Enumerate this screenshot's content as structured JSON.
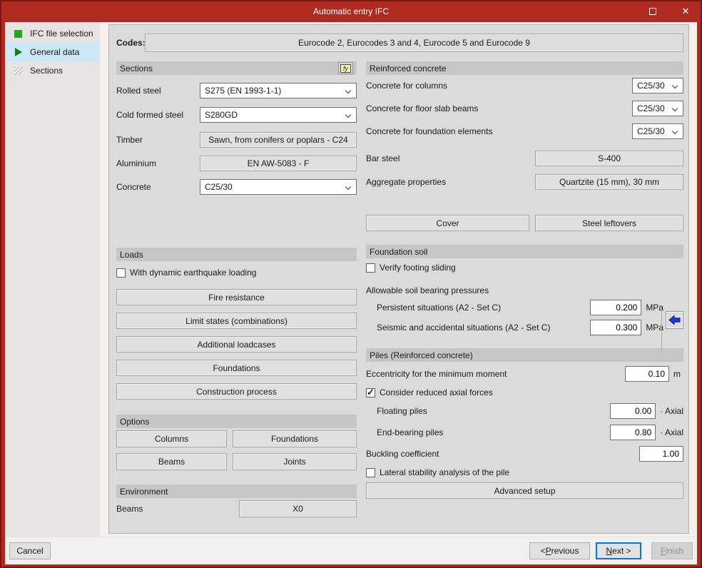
{
  "glyphs": {
    "close": "✕",
    "check": "✓",
    "fy": "fy"
  },
  "colors": {
    "titlebar_red": "#AF2B1F",
    "selected_step_blue": "#CBE8F6",
    "default_button_blue": "#0078D7",
    "arrow_blue": "#2438D8",
    "step_done_green": "#28A228"
  },
  "titlebar": {
    "title": "Automatic entry IFC"
  },
  "sidebar": {
    "items": [
      {
        "label": "IFC file selection",
        "state": "done"
      },
      {
        "label": "General data",
        "state": "current"
      },
      {
        "label": "Sections",
        "state": "pending"
      }
    ]
  },
  "codes": {
    "label": "Codes:",
    "value": "Eurocode 2, Eurocodes 3 and 4, Eurocode 5 and Eurocode 9"
  },
  "sections": {
    "title": "Sections",
    "rolled_steel_label": "Rolled steel",
    "rolled_steel_value": "S275 (EN 1993-1-1)",
    "cold_formed_label": "Cold formed steel",
    "cold_formed_value": "S280GD",
    "timber_label": "Timber",
    "timber_value": "Sawn, from conifers or poplars - C24",
    "aluminium_label": "Aluminium",
    "aluminium_value": "EN AW-5083 - F",
    "concrete_label": "Concrete",
    "concrete_value": "C25/30"
  },
  "loads": {
    "title": "Loads",
    "dynamic_checkbox_label": "With dynamic earthquake loading",
    "dynamic_checked": false,
    "buttons": [
      "Fire resistance",
      "Limit states (combinations)",
      "Additional loadcases",
      "Foundations",
      "Construction process"
    ]
  },
  "options": {
    "title": "Options",
    "buttons": [
      "Columns",
      "Foundations",
      "Beams",
      "Joints"
    ]
  },
  "environment": {
    "title": "Environment",
    "beams_label": "Beams",
    "beams_value": "X0"
  },
  "reinforced_concrete": {
    "title": "Reinforced concrete",
    "columns_label": "Concrete for columns",
    "columns_value": "C25/30",
    "floor_label": "Concrete for floor slab beams",
    "floor_value": "C25/30",
    "foundation_label": "Concrete for foundation elements",
    "foundation_value": "C25/30",
    "bar_steel_label": "Bar steel",
    "bar_steel_value": "S-400",
    "aggregate_label": "Aggregate properties",
    "aggregate_value": "Quartzite (15 mm), 30 mm",
    "cover_button": "Cover",
    "steel_leftovers_button": "Steel leftovers"
  },
  "foundation_soil": {
    "title": "Foundation soil",
    "verify_checkbox_label": "Verify footing sliding",
    "verify_checked": false,
    "pressures_label": "Allowable soil bearing pressures",
    "persistent_label": "Persistent situations (A2 - Set C)",
    "persistent_value": "0.200",
    "persistent_unit": "MPa",
    "seismic_label": "Seismic and accidental situations (A2 - Set C)",
    "seismic_value": "0.300",
    "seismic_unit": "MPa"
  },
  "piles": {
    "title": "Piles (Reinforced concrete)",
    "eccentricity_label": "Eccentricity for the minimum moment",
    "eccentricity_value": "0.10",
    "eccentricity_unit": "m",
    "reduced_checkbox_label": "Consider reduced axial forces",
    "reduced_checked": true,
    "floating_label": "Floating piles",
    "floating_value": "0.00",
    "floating_unit": "· Axial",
    "end_bearing_label": "End-bearing piles",
    "end_bearing_value": "0.80",
    "end_bearing_unit": "· Axial",
    "buckling_label": "Buckling coefficient",
    "buckling_value": "1.00",
    "lateral_checkbox_label": "Lateral stability analysis of the pile",
    "lateral_checked": false,
    "advanced_button": "Advanced setup"
  },
  "footer": {
    "cancel": "Cancel",
    "previous_prefix": "< ",
    "previous_accel": "P",
    "previous_rest": "revious",
    "next_accel": "N",
    "next_rest": "ext >",
    "finish_accel": "F",
    "finish_rest": "inish"
  }
}
